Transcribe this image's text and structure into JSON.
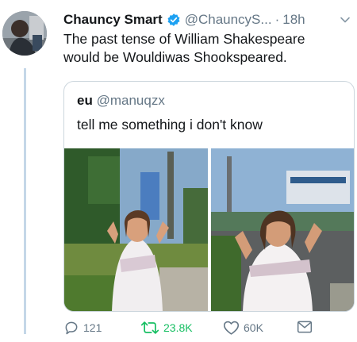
{
  "tweet": {
    "author_name": "Chauncy Smart",
    "author_handle": "@ChauncyS...",
    "separator": "·",
    "timestamp": "18h",
    "text_line1": "The past tense of William Shakespeare",
    "text_line2": "would be Wouldiwas Shookspeared.",
    "verified_icon": "verified-badge-icon",
    "accent_color": "#1da1f2"
  },
  "quoted_tweet": {
    "author_name": "eu",
    "author_handle": "@manuqzx",
    "text": "tell me something i don't know",
    "media": [
      "photo-left",
      "photo-right"
    ]
  },
  "actions": {
    "replies": "121",
    "retweets": "23.8K",
    "likes": "60K",
    "retweet_color": "#17bf63",
    "icons": [
      "reply-icon",
      "retweet-icon",
      "like-icon",
      "message-icon"
    ]
  }
}
